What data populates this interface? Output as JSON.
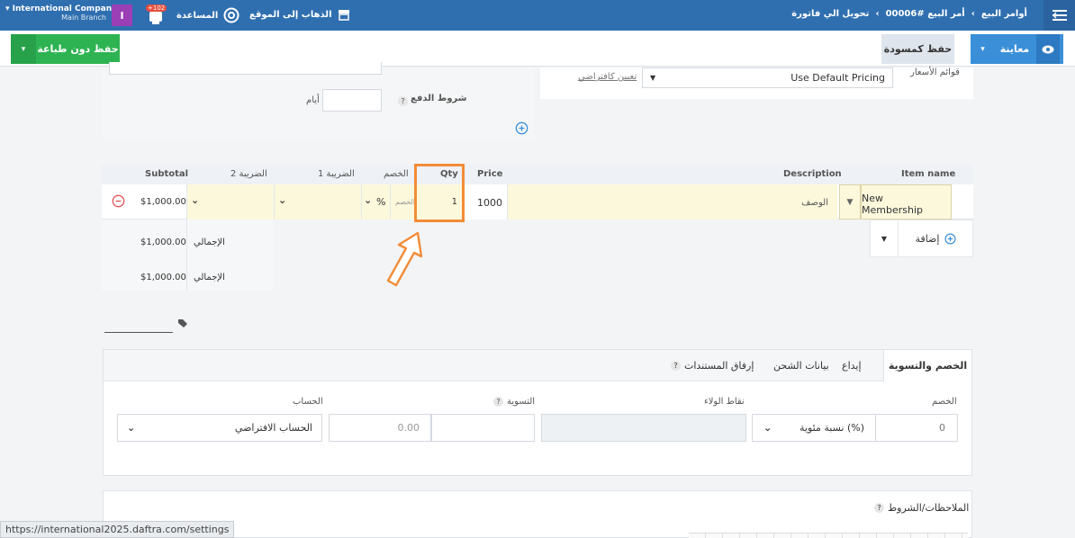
{
  "topbar": {
    "company_name": "International Company",
    "branch_name": "Main Branch",
    "avatar_letter": "I",
    "notification_count": "+102",
    "help_label": "المساعدة",
    "visit_site_label": "الذهاب إلى الموقع",
    "breadcrumb": {
      "root": "أوامر البيع",
      "order": "أمر البيع #00006",
      "current": "تحويل الي فاتورة"
    }
  },
  "actions": {
    "save_no_print": "حفظ دون طباعة",
    "save_draft": "حفظ كمسودة",
    "preview": "معاينة"
  },
  "form": {
    "payment_terms_label": "شروط الدفع",
    "days_label": "أيام",
    "price_lists_label": "قوائم الأسعار",
    "price_list_value": "Use Default Pricing",
    "set_default_link": "تعيين كافتراضي"
  },
  "items_table": {
    "headers": {
      "item_name": "Item name",
      "description": "Description",
      "price": "Price",
      "qty": "Qty",
      "discount": "الخصم",
      "tax1": "الضريبة 1",
      "tax2": "الضريبة 2",
      "subtotal": "Subtotal"
    },
    "row": {
      "item_name": "New Membership",
      "description_placeholder": "الوصف",
      "price": "1000",
      "qty": "1",
      "discount_placeholder": "الخصم",
      "discount_type": "%",
      "subtotal": "$1,000.00"
    },
    "add_label": "إضافة",
    "totals": [
      {
        "label": "الإجمالي",
        "value": "$1,000.00"
      },
      {
        "label": "الإجمالي",
        "value": "$1,000.00"
      }
    ]
  },
  "tabs": {
    "items": [
      "الخصم والتسوية",
      "إيداع",
      "بيانات الشحن",
      "إرفاق المستندات"
    ],
    "discount_label": "الخصم",
    "discount_value": "0",
    "discount_type": "نسبة مئوية (%)",
    "loyalty_label": "نقاط الولاء",
    "adjustment_label": "التسوية",
    "adjustment_placeholder": "0.00",
    "account_label": "الحساب",
    "account_value": "الحساب الافتراضي"
  },
  "notes": {
    "label": "الملاحظات/الشروط"
  },
  "status_bar": {
    "url": "https://international2025.daftra.com/settings"
  },
  "colors": {
    "topbar": "#2f6fb0",
    "save_button": "#2eb352",
    "preview_button": "#3a8fd8",
    "highlight": "#f28c38",
    "row_fill": "#fcf8dc"
  }
}
